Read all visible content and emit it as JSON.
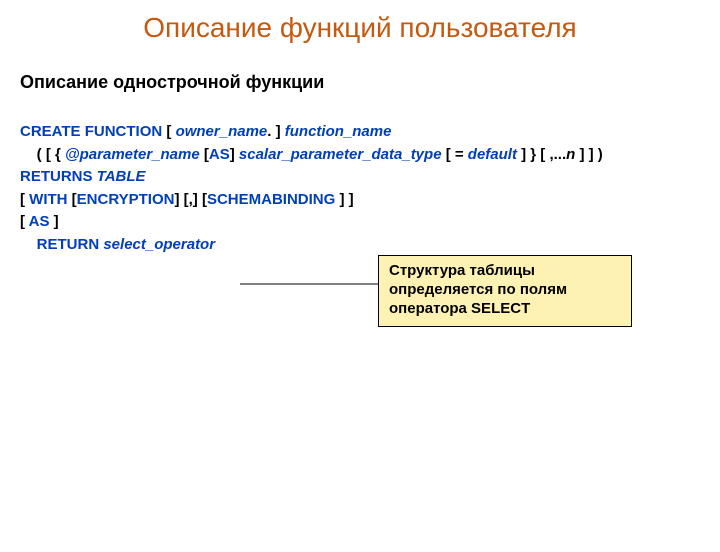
{
  "title": "Описание функций пользователя",
  "subtitle": "Описание однострочной функции",
  "syntax": {
    "l1": {
      "kw": "CREATE  FUNCTION ",
      "b1": "[ ",
      "a1": "owner_name",
      "b2": ". ] ",
      "a2": "function_name"
    },
    "l2": {
      "indent": "    ",
      "b1": "( [ { ",
      "a1": "@parameter_name ",
      "b2": "[",
      "kw": "AS",
      "b3": "] ",
      "a2": "scalar_parameter_data_type ",
      "b4": "[ = ",
      "a3": "default ",
      "b5": "] } [ ,...",
      "a4": "n ",
      "b6": "] ] )"
    },
    "l3": {
      "kw": "RETURNS ",
      "a1": "TABLE"
    },
    "l4": {
      "b1": "[ ",
      "kw1": "WITH ",
      "b2": "[",
      "kw2": "ENCRYPTION",
      "b3": "] [,] [",
      "kw3": "SCHEMABINDING ",
      "b4": "] ]"
    },
    "l5": {
      "b1": "[ ",
      "kw": "AS ",
      "b2": "]"
    },
    "l6": {
      "indent": "    ",
      "kw": "RETURN ",
      "a1": "select_operator"
    }
  },
  "note": "Структура таблицы определяется по полям оператора SELECT"
}
